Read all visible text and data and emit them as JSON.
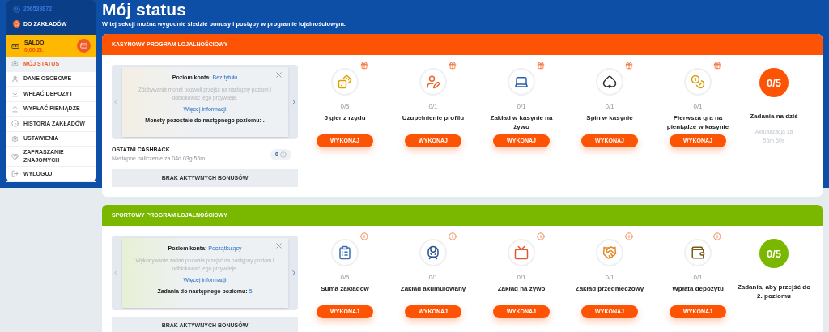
{
  "sidebar": {
    "user_id": "256539872",
    "back_link": "DO ZAKŁADÓW",
    "balance": {
      "label": "SALDO",
      "value": "0,00 Zł."
    },
    "items": [
      {
        "label": "MÓJ STATUS",
        "selected": true
      },
      {
        "label": "DANE OSOBOWE",
        "selected": false
      },
      {
        "label": "WPŁAĆ DEPOZYT",
        "selected": false
      },
      {
        "label": "WYPŁAĆ PIENIĄDZE",
        "selected": false
      },
      {
        "label": "HISTORIA ZAKŁADÓW",
        "selected": false
      },
      {
        "label": "USTAWIENIA",
        "selected": false
      },
      {
        "label": "ZAPRASZANIE ZNAJOMYCH",
        "selected": false
      },
      {
        "label": "WYLOGUJ",
        "selected": false
      }
    ]
  },
  "page": {
    "title": "Mój status",
    "subtitle": "W tej sekcji można wygodnie śledzić bonusy i postępy w programie lojalnościowym."
  },
  "programs": [
    {
      "kind": "casino",
      "title": "KASYNOWY PROGRAM LOJALNOŚCIOWY",
      "color": "#fd5304",
      "popup": {
        "level_label": "Poziom konta:",
        "level_value": "Bez tytułu",
        "description": "Zdobywanie monet pozwoli przejść na następny poziom i odblokować jego przywileje.",
        "link": "Więcej informacji",
        "next_label": "Monety pozostałe do następnego poziomu:",
        "next_value": "."
      },
      "cashback": {
        "title": "OSTATNI CASHBACK",
        "subtitle": "Następne naliczenie za 04d 03g 56m",
        "value": "0"
      },
      "bonuses": "BRAK AKTYWNYCH BONUSÓW",
      "tasks": [
        {
          "progress": "0/5",
          "completed": false,
          "label": "5 gier z rzędu",
          "button": "WYKONAJ"
        },
        {
          "progress": "0/1",
          "completed": false,
          "label": "Uzupełnienie profilu",
          "button": "WYKONAJ"
        },
        {
          "progress": "0/1",
          "completed": false,
          "label": "Zakład w kasynie na żywo",
          "button": "WYKONAJ"
        },
        {
          "progress": "0/1",
          "completed": false,
          "label": "Spin w kasynie",
          "button": "WYKONAJ"
        },
        {
          "progress": "0/1",
          "completed": false,
          "label": "Pierwsza gra na pieniądze w kasynie",
          "button": "WYKONAJ"
        }
      ],
      "summary": {
        "value": "0/5",
        "label": "Zadania na dziś",
        "note": "Aktualizacja za 56m 50s"
      }
    },
    {
      "kind": "sport",
      "title": "SPORTOWY PROGRAM LOJALNOŚCIOWY",
      "color": "#7ab800",
      "popup": {
        "level_label": "Poziom konta:",
        "level_value": "Początkujący",
        "description": "Wykonywanie zadań pozwala przejść na następny poziom i odblokować jego przywileje.",
        "link": "Więcej informacji",
        "next_label": "Zadania do następnego poziomu:",
        "next_value": "5"
      },
      "bonuses": "BRAK AKTYWNYCH BONUSÓW",
      "tasks": [
        {
          "progress": "0/5",
          "completed": false,
          "label": "Suma zakładów",
          "button": "WYKONAJ"
        },
        {
          "progress": "0/1",
          "completed": false,
          "label": "Zakład akumulowany",
          "button": "WYKONAJ"
        },
        {
          "progress": "0/1",
          "completed": false,
          "label": "Zakład na żywo",
          "button": "WYKONAJ"
        },
        {
          "progress": "0/1",
          "completed": false,
          "label": "Zakład przedmeczowy",
          "button": "WYKONAJ"
        },
        {
          "progress": "0/1",
          "completed": false,
          "label": "Wpłata depozytu",
          "button": "WYKONAJ"
        }
      ],
      "summary": {
        "value": "0/5",
        "label": "Zadania, aby przejść do 2. poziomu"
      }
    }
  ]
}
